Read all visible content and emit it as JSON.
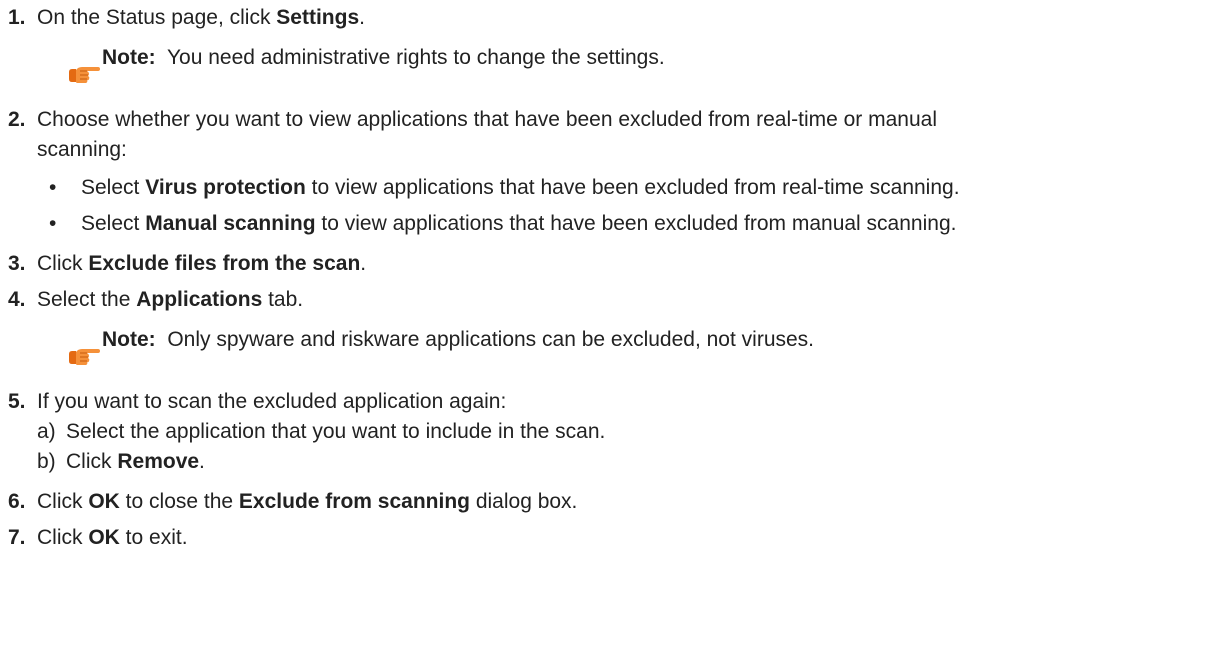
{
  "steps": [
    {
      "num": "1.",
      "pre": "On the Status page, click ",
      "bold": "Settings",
      "post": "."
    },
    {
      "num": "2.",
      "text_line1": "Choose whether you want to view applications that have been excluded from real-time or manual",
      "text_line2": "scanning:"
    },
    {
      "num": "3.",
      "pre": "Click ",
      "bold": "Exclude files from the scan",
      "post": "."
    },
    {
      "num": "4.",
      "pre": "Select the ",
      "bold": "Applications",
      "post": " tab."
    },
    {
      "num": "5.",
      "text": "If you want to scan the excluded application again:"
    },
    {
      "num": "6.",
      "pre": "Click ",
      "bold": "OK",
      "mid": " to close the ",
      "bold2": "Exclude from scanning",
      "post": " dialog box."
    },
    {
      "num": "7.",
      "pre": "Click ",
      "bold": "OK",
      "post": " to exit."
    }
  ],
  "notes": [
    {
      "label": "Note:",
      "text": "You need administrative rights to change the settings."
    },
    {
      "label": "Note:",
      "text": "Only spyware and riskware applications can be excluded, not viruses."
    }
  ],
  "bullets": [
    {
      "dot": "•",
      "pre": "Select ",
      "bold": "Virus protection",
      "post": " to view applications that have been excluded from real-time scanning."
    },
    {
      "dot": "•",
      "pre": "Select ",
      "bold": "Manual scanning",
      "post": " to view applications that have been excluded from manual scanning."
    }
  ],
  "substeps": [
    {
      "letter": "a)",
      "text": "Select the application that you want to include in the scan."
    },
    {
      "letter": "b)",
      "pre": "Click ",
      "bold": "Remove",
      "post": "."
    }
  ],
  "icons": {
    "note": "pointing-hand-icon"
  },
  "colors": {
    "text": "#222222",
    "note_icon": "#f07a1a"
  }
}
